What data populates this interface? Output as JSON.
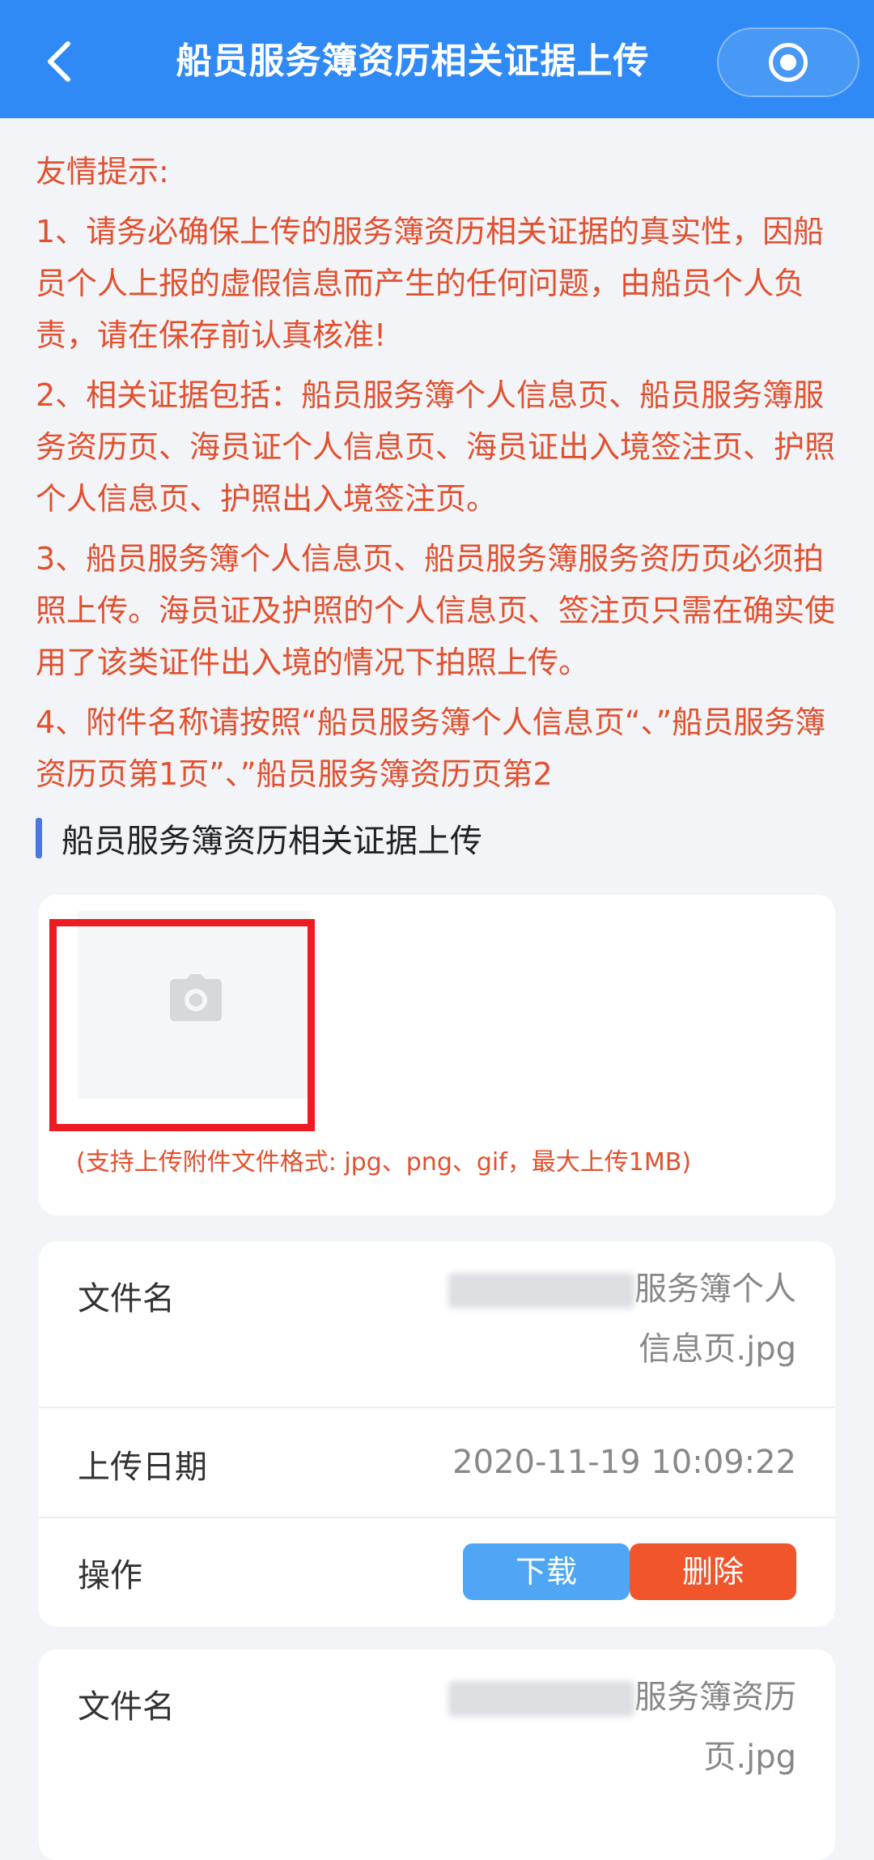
{
  "header": {
    "title": "船员服务簿资历相关证据上传"
  },
  "notice": {
    "heading": "友情提示:",
    "items": [
      "1、请务必确保上传的服务簿资历相关证据的真实性，因船员个人上报的虚假信息而产生的任何问题，由船员个人负责，请在保存前认真核准!",
      "2、相关证据包括：船员服务簿个人信息页、船员服务簿服务资历页、海员证个人信息页、海员证出入境签注页、护照个人信息页、护照出入境签注页。",
      "3、船员服务簿个人信息页、船员服务簿服务资历页必须拍照上传。海员证及护照的个人信息页、签注页只需在确实使用了该类证件出入境的情况下拍照上传。",
      "4、附件名称请按照“船员服务簿个人信息页“、”船员服务簿资历页第1页”、”船员服务簿资历页第2"
    ]
  },
  "section": {
    "title": "船员服务簿资历相关证据上传"
  },
  "upload": {
    "hint": "(支持上传附件文件格式: jpg、png、gif，最大上传1MB)"
  },
  "files": [
    {
      "name_label": "文件名",
      "name_line1": "服务簿个人",
      "name_line2": "信息页.jpg",
      "date_label": "上传日期",
      "date_value": "2020-11-19 10:09:22",
      "op_label": "操作",
      "download": "下载",
      "delete": "删除"
    },
    {
      "name_label": "文件名",
      "name_line1": "服务簿资历",
      "name_line2": "页.jpg"
    }
  ],
  "colors": {
    "header_bg": "#2f8af5",
    "notice_text": "#e2502e",
    "download_btn": "#4ea6f4",
    "delete_btn": "#f0552c",
    "highlight_box": "#ee1b22"
  }
}
